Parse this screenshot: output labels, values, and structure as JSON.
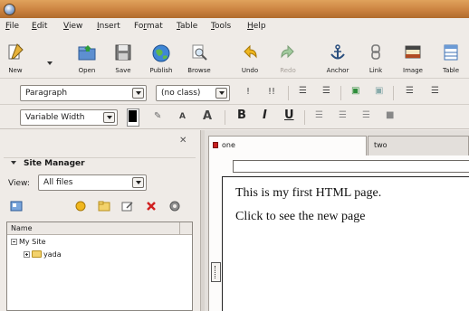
{
  "menubar": {
    "items": [
      {
        "first": "F",
        "rest": "ile"
      },
      {
        "first": "E",
        "rest": "dit"
      },
      {
        "first": "V",
        "rest": "iew"
      },
      {
        "first": "I",
        "rest": "nsert"
      },
      {
        "first": "F",
        "rest": "o",
        "mid": "r",
        "tail": "mat"
      },
      {
        "first": "T",
        "rest": "able"
      },
      {
        "first": "T",
        "rest": "ools"
      },
      {
        "first": "H",
        "rest": "elp"
      }
    ]
  },
  "toolbar": {
    "new": "New",
    "open": "Open",
    "save": "Save",
    "publish": "Publish",
    "browse": "Browse",
    "undo": "Undo",
    "redo": "Redo",
    "anchor": "Anchor",
    "link": "Link",
    "image": "Image",
    "table": "Table"
  },
  "format_toolbar": {
    "paragraph_format": "Paragraph",
    "class": "(no class)",
    "font": "Variable Width",
    "icons": [
      "remove-text-styles-icon",
      "remove-links-icon",
      "numbered-list-icon",
      "bullet-list-icon",
      "indent-icon",
      "outdent-icon",
      "align-left-icon",
      "align-right-icon"
    ]
  },
  "text_toolbar": {
    "bold": "B",
    "italic": "I",
    "underline": "U",
    "smaller": "A",
    "larger": "A"
  },
  "site_manager": {
    "title": "Site Manager",
    "view_label": "View:",
    "view_value": "All files",
    "tree_header": "Name",
    "tree": [
      {
        "label": "My Site",
        "expander": "minus",
        "level": 0
      },
      {
        "label": "yada",
        "expander": "plus",
        "level": 1
      }
    ]
  },
  "editor": {
    "tabs": [
      {
        "label": "one",
        "active": true
      },
      {
        "label": "two",
        "active": false
      }
    ],
    "address_value": "",
    "content": [
      "This is my first HTML page.",
      "Click to see the new page"
    ]
  },
  "colors": {
    "titlebar": "#c9803e",
    "chrome": "#efebe7",
    "text_color_swatch": "#000000"
  }
}
